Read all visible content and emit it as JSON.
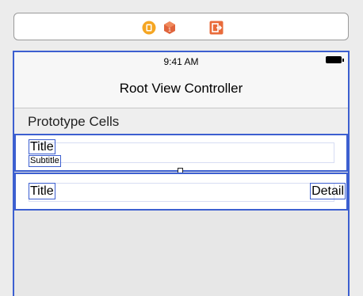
{
  "dock": {
    "icons": [
      "view-controller-icon",
      "first-responder-icon",
      "exit-icon"
    ],
    "colors": {
      "vc": "#f5a623",
      "responder": "#e0643c",
      "exit": "#e96b3a"
    }
  },
  "status_bar": {
    "time": "9:41 AM"
  },
  "nav": {
    "title": "Root View Controller"
  },
  "table": {
    "section_header": "Prototype Cells",
    "cells": [
      {
        "title": "Title",
        "subtitle": "Subtitle"
      },
      {
        "title": "Title",
        "detail": "Detail"
      }
    ]
  },
  "accent": "#3c5fd0"
}
